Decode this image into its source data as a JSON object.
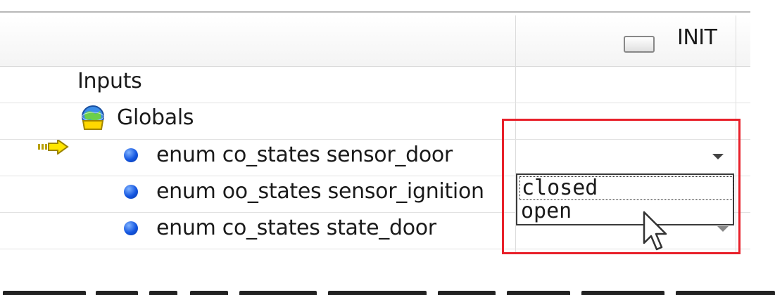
{
  "column_header": {
    "label": "INIT",
    "icon": "checkbox-header-icon"
  },
  "tree": {
    "inputs": {
      "label": "Inputs",
      "icon": "inputs-arrow-icon"
    },
    "globals": {
      "label": "Globals",
      "icon": "globe-icon"
    },
    "variables": [
      {
        "label": "enum co_states sensor_door",
        "icon": "blue-dot-icon"
      },
      {
        "label": "enum oo_states sensor_ignition",
        "icon": "blue-dot-icon"
      },
      {
        "label": "enum co_states state_door",
        "icon": "blue-dot-icon"
      }
    ]
  },
  "dropdown": {
    "options": [
      {
        "label": "closed",
        "selected": true
      },
      {
        "label": "open",
        "selected": false
      }
    ]
  },
  "colors": {
    "highlight_border": "#e8202a",
    "dot": "#1456e0"
  }
}
